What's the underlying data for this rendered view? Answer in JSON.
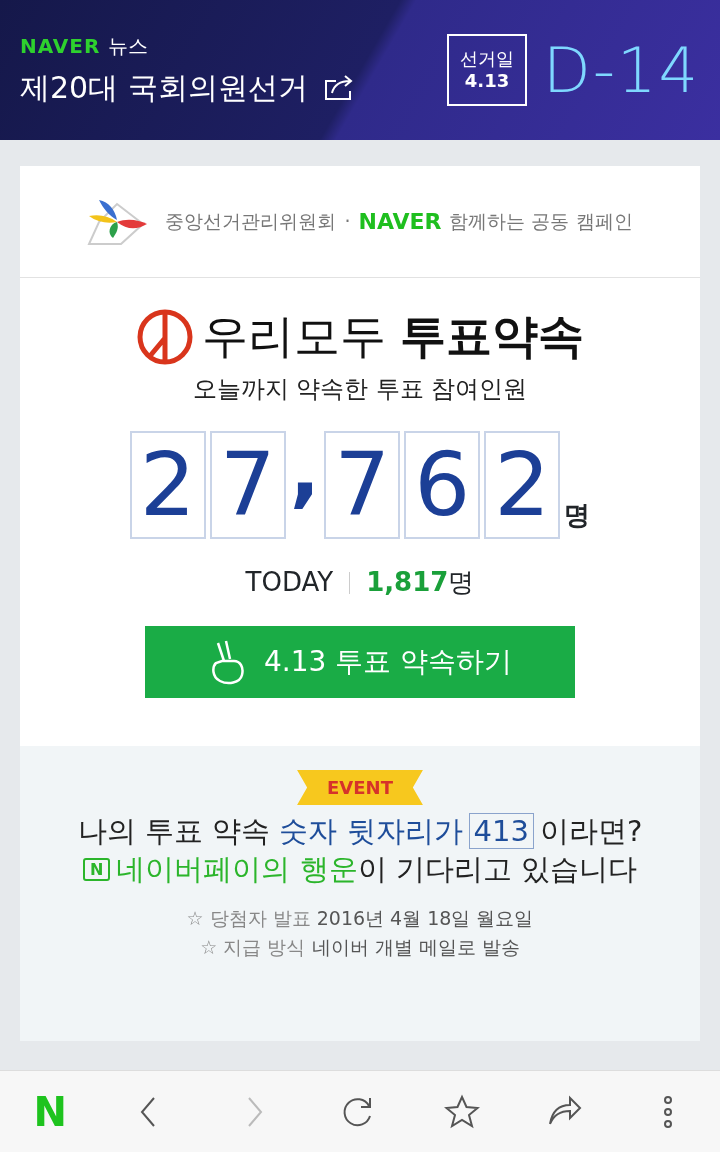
{
  "header": {
    "brand": "NAVER",
    "section": "뉴스",
    "title": "제20대 국회의원선거",
    "election_label": "선거일",
    "election_date": "4.13",
    "dday": "D-14"
  },
  "campaign": {
    "org": "중앙선거관리위원회",
    "dot": "·",
    "brand": "NAVER",
    "tagline": "함께하는 공동 캠페인"
  },
  "pledge": {
    "title_light": "우리모두",
    "title_bold": "투표약속",
    "subtitle": "오늘까지 약속한 투표 참여인원",
    "counter": [
      {
        "kind": "digit",
        "text": "2"
      },
      {
        "kind": "digit",
        "text": "7"
      },
      {
        "kind": "comma",
        "text": ","
      },
      {
        "kind": "digit",
        "text": "7"
      },
      {
        "kind": "digit",
        "text": "6"
      },
      {
        "kind": "digit",
        "text": "2"
      }
    ],
    "unit": "명",
    "today_label": "TODAY",
    "today_count": "1,817",
    "today_unit": "명",
    "button": "4.13 투표 약속하기"
  },
  "event": {
    "badge": "EVENT",
    "line_1": [
      {
        "kind": "plain",
        "text": "나의 투표 약속 "
      },
      {
        "kind": "blue",
        "text": "숫자 뒷자리가"
      },
      {
        "kind": "boxed",
        "text": "413"
      },
      {
        "kind": "plain",
        "text": "이라면?"
      }
    ],
    "line_2": [
      {
        "kind": "logo",
        "text": "N"
      },
      {
        "kind": "green",
        "text": "네이버페이의 행운"
      },
      {
        "kind": "plain",
        "text": "이 기다리고 있습니다"
      }
    ],
    "details": [
      {
        "star": "☆",
        "label": "당첨자 발표",
        "value": "2016년 4월 18일 월요일"
      },
      {
        "star": "☆",
        "label": "지급 방식",
        "value": "네이버 개별 메일로 발송"
      }
    ]
  },
  "toolbar": [
    {
      "kind": "home",
      "text": "N",
      "disabled": false
    },
    {
      "kind": "back",
      "disabled": false
    },
    {
      "kind": "forward",
      "disabled": true
    },
    {
      "kind": "reload",
      "disabled": false
    },
    {
      "kind": "bookmark",
      "disabled": false
    },
    {
      "kind": "share",
      "disabled": false
    },
    {
      "kind": "more",
      "disabled": false
    }
  ]
}
